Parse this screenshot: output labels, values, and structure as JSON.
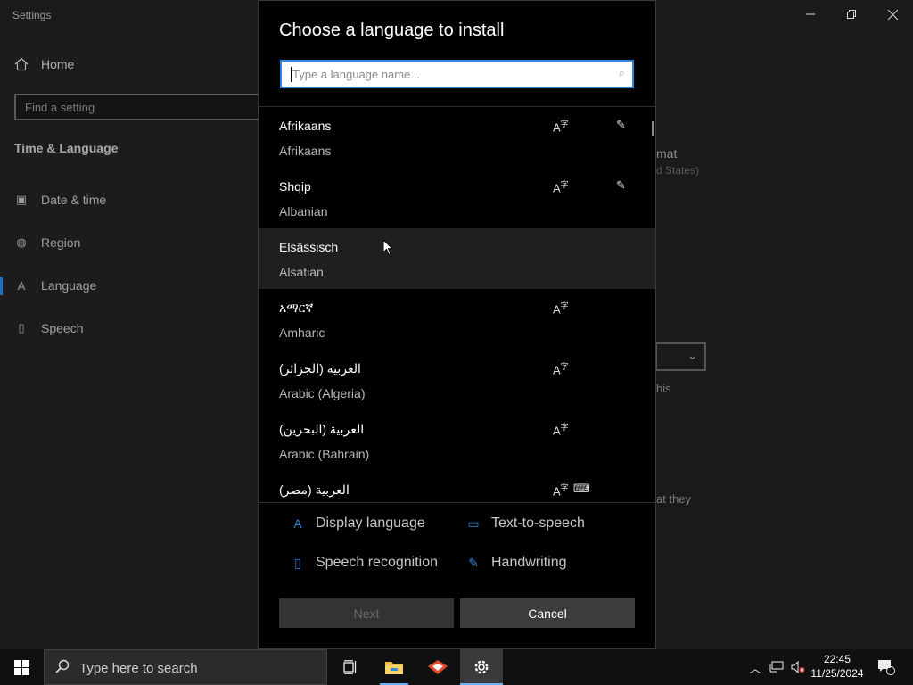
{
  "settings": {
    "app_title": "Settings",
    "home_label": "Home",
    "find_placeholder": "Find a setting",
    "section_title": "Time & Language",
    "nav": [
      {
        "label": "Date & time",
        "icon": "calendar-clock-icon"
      },
      {
        "label": "Region",
        "icon": "globe-icon"
      },
      {
        "label": "Language",
        "icon": "language-icon",
        "active": true
      },
      {
        "label": "Speech",
        "icon": "microphone-icon"
      }
    ],
    "bg_fragments": {
      "frag1": "mat",
      "frag2": "d States)",
      "frag3": "his",
      "frag4": "at they"
    }
  },
  "dialog": {
    "title": "Choose a language to install",
    "search_placeholder": "Type a language name...",
    "languages": [
      {
        "native": "Afrikaans",
        "english": "Afrikaans",
        "display": true,
        "handwriting": true,
        "tts": false
      },
      {
        "native": "Shqip",
        "english": "Albanian",
        "display": true,
        "handwriting": true,
        "tts": false
      },
      {
        "native": "Elsässisch",
        "english": "Alsatian",
        "display": false,
        "handwriting": false,
        "tts": false,
        "hover": true
      },
      {
        "native": "አማርኛ",
        "english": "Amharic",
        "display": true,
        "handwriting": false,
        "tts": false
      },
      {
        "native": "العربية (الجزائر)",
        "english": "Arabic (Algeria)",
        "display": true,
        "handwriting": false,
        "tts": false
      },
      {
        "native": "العربية (البحرين)",
        "english": "Arabic (Bahrain)",
        "display": true,
        "handwriting": false,
        "tts": false
      },
      {
        "native": "العربية (مصر)",
        "english": "",
        "display": true,
        "handwriting": false,
        "tts": true
      }
    ],
    "legend": {
      "display_language": "Display language",
      "text_to_speech": "Text-to-speech",
      "speech_recognition": "Speech recognition",
      "handwriting": "Handwriting"
    },
    "next_label": "Next",
    "cancel_label": "Cancel",
    "accent_color": "#2b83d6"
  },
  "taskbar": {
    "search_placeholder": "Type here to search",
    "time": "22:45",
    "date": "11/25/2024",
    "notification_count": "1"
  }
}
